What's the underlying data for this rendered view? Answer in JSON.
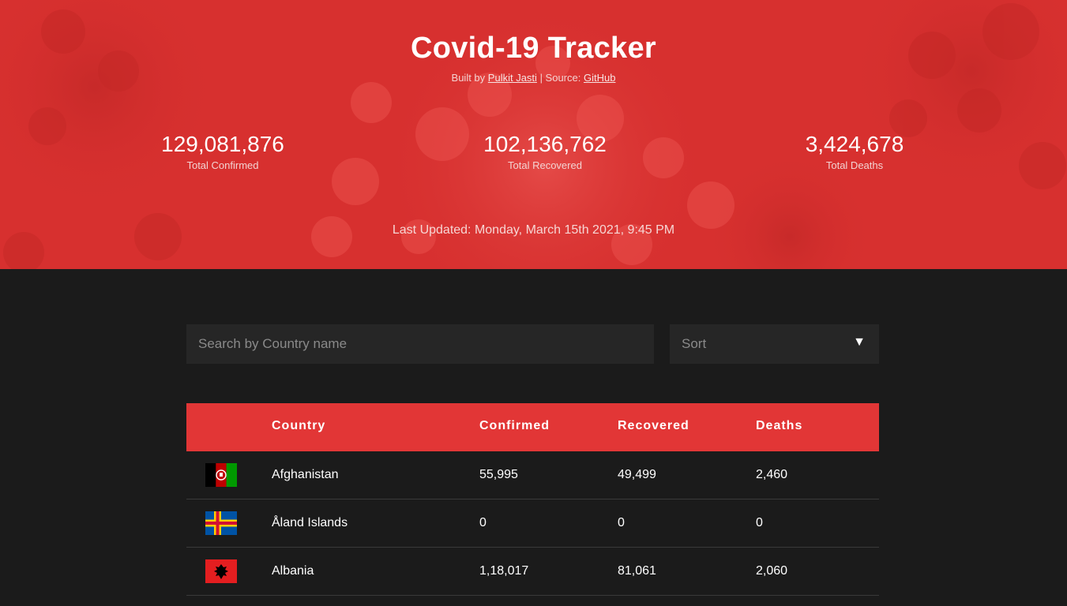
{
  "header": {
    "title": "Covid-19 Tracker",
    "built_by_prefix": "Built by",
    "author_link": "Pulkit Jasti",
    "separator": "| Source:",
    "source_link": "GitHub",
    "accent_color": "#d7302f"
  },
  "stats": {
    "confirmed": {
      "value": "129,081,876",
      "label": "Total Confirmed"
    },
    "recovered": {
      "value": "102,136,762",
      "label": "Total Recovered"
    },
    "deaths": {
      "value": "3,424,678",
      "label": "Total Deaths"
    }
  },
  "last_updated": "Last Updated: Monday, March 15th 2021, 9:45 PM",
  "controls": {
    "search_placeholder": "Search by Country name",
    "sort_label": "Sort",
    "sort_icon": "triangle-down-icon"
  },
  "table": {
    "header_color": "#e23636",
    "columns": [
      "Country",
      "Confirmed",
      "Recovered",
      "Deaths"
    ],
    "rows": [
      {
        "flag": "afghanistan-flag-icon",
        "country": "Afghanistan",
        "confirmed": "55,995",
        "recovered": "49,499",
        "deaths": "2,460"
      },
      {
        "flag": "aland-islands-flag-icon",
        "country": "Åland Islands",
        "confirmed": "0",
        "recovered": "0",
        "deaths": "0"
      },
      {
        "flag": "albania-flag-icon",
        "country": "Albania",
        "confirmed": "1,18,017",
        "recovered": "81,061",
        "deaths": "2,060"
      }
    ]
  }
}
